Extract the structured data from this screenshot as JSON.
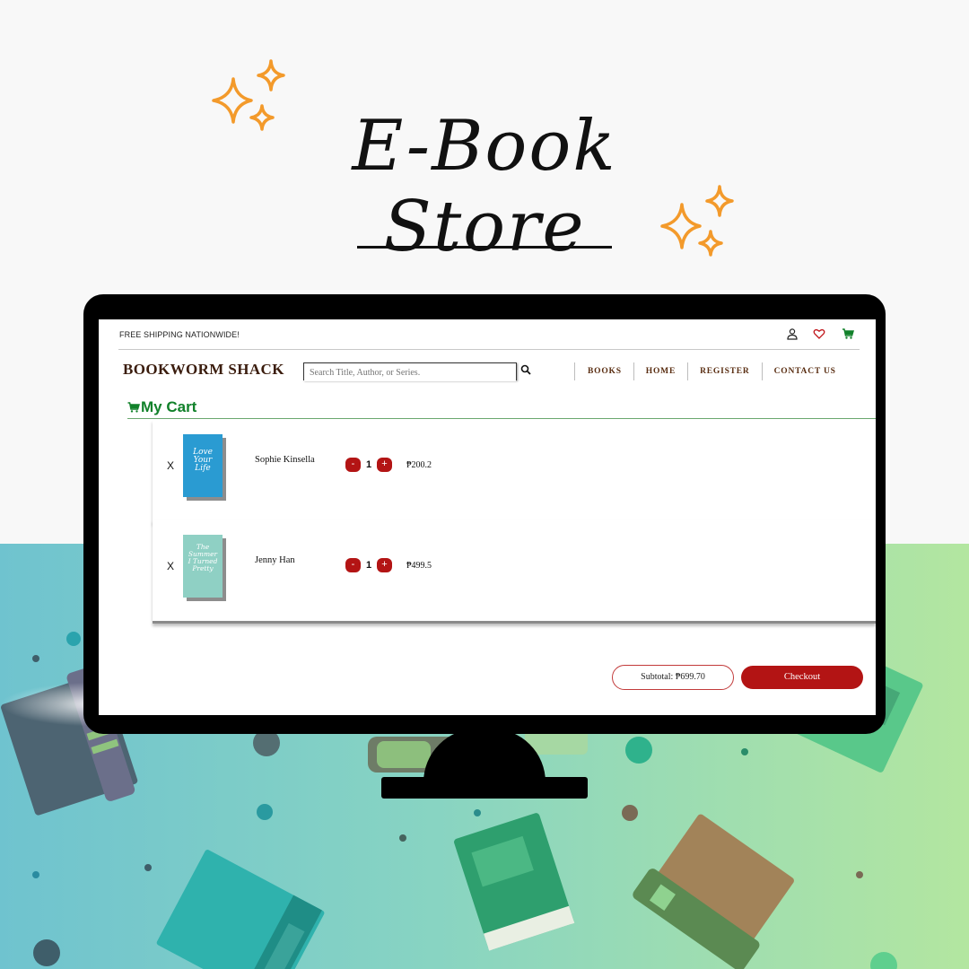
{
  "promo": {
    "headline": "E-Book Store"
  },
  "site": {
    "banner": "FREE SHIPPING NATIONWIDE!",
    "brand": "BOOKWORM SHACK",
    "search": {
      "placeholder": "Search Title, Author, or Series."
    },
    "nav": [
      "BOOKS",
      "HOME",
      "REGISTER",
      "CONTACT US"
    ],
    "icons": {
      "account": "user-icon",
      "wishlist": "heart-icon",
      "cart": "cart-icon",
      "search": "search-icon"
    }
  },
  "cart": {
    "title": "My Cart",
    "remove_label": "X",
    "decrement_label": "-",
    "increment_label": "+",
    "items": [
      {
        "author": "Sophie Kinsella",
        "quantity": "1",
        "price": "₱200.2",
        "cover_title": "Love Your Life",
        "cover_color": "#2a9bd2"
      },
      {
        "author": "Jenny Han",
        "quantity": "1",
        "price": "₱499.5",
        "cover_title": "The Summer I Turned Pretty",
        "cover_color": "#8fd0c4"
      }
    ],
    "subtotal": "Subtotal: ₱699.70",
    "checkout_label": "Checkout"
  },
  "colors": {
    "accent_red": "#b31414",
    "cart_green": "#11812a",
    "brand_brown": "#3b1d0e",
    "sparkle_orange": "#f39a2b"
  }
}
